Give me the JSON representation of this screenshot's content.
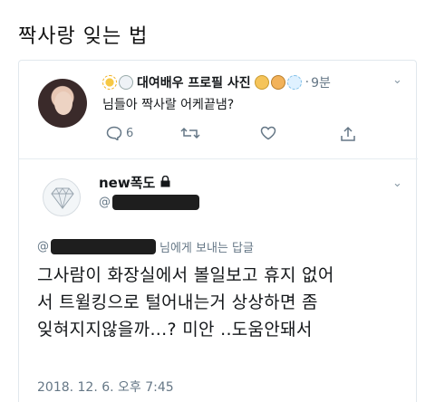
{
  "post": {
    "title": "짝사랑 잊는 법"
  },
  "tweet1": {
    "display_name": "대여배우 프로필 사진",
    "time": "9분",
    "dot": "·",
    "text": "님들아 짝사랄 어케끝냄?",
    "reply_count": "6",
    "icons": [
      "sun-emoji",
      "snowman-emoji",
      "face-emoji",
      "face-emoji",
      "snowflake-emoji",
      "chevron-down-icon",
      "reply-icon",
      "retweet-icon",
      "like-icon",
      "share-icon"
    ]
  },
  "tweet2": {
    "display_name": "new폭도",
    "handle_prefix": "@",
    "reply_suffix_prefix": "@",
    "reply_suffix": "님에게 보내는 답글",
    "body_lines": [
      "그사람이 화장실에서 볼일보고 휴지 없어",
      "서 트윌킹으로 털어내는거 상상하면 좀",
      "잊혀지지않을까...? 미안 ..도움안돼서"
    ],
    "timestamp": "2018. 12. 6. 오후 7:45",
    "icons": [
      "diamond-avatar-icon",
      "lock-icon",
      "chevron-down-icon"
    ]
  },
  "colors": {
    "text": "#14171a",
    "muted": "#657786",
    "border": "#e1e8ed",
    "redaction": "#1e1e1e"
  }
}
